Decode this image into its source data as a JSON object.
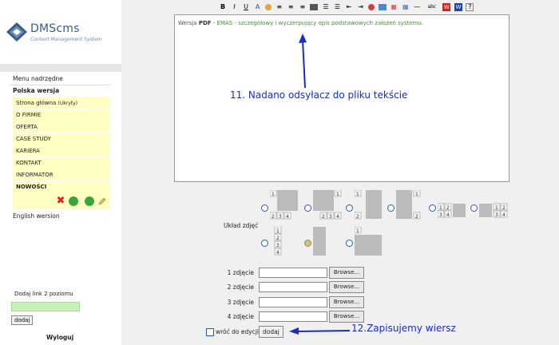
{
  "logo": {
    "title": "DMScms",
    "subtitle": "Content Management System"
  },
  "menu": {
    "parent": "Menu nadrzędne",
    "section": "Polska wersja",
    "items": [
      {
        "label": "Strona główna",
        "badge": "(Ukryty)"
      },
      {
        "label": "O FIRMIE"
      },
      {
        "label": "OFERTA"
      },
      {
        "label": "CASE STUDY"
      },
      {
        "label": "KARIERA"
      },
      {
        "label": "KONTAKT"
      },
      {
        "label": "INFORMATOR"
      },
      {
        "label": "NOWOŚCI"
      }
    ],
    "english": "English wersion"
  },
  "sidebar_bottom": {
    "add_label": "Dodaj link 2 poziomu",
    "add_button": "dodaj",
    "logout": "Wyloguj"
  },
  "toolbar": [
    "B",
    "I",
    "U",
    "A"
  ],
  "editor": {
    "prefix": "Wersja",
    "pdf": "PDF",
    "dash": " - ",
    "link_text": "EMAS - szczegółowy i wyczerpujący opis podstawowych założeń systemu."
  },
  "annotations": {
    "a1": "11. Nadano odsyłacz do pliku tekście",
    "a2": "12.Zapisujemy wiersz"
  },
  "layout": {
    "label": "Układ zdjęć",
    "selected_index": 6
  },
  "photos": {
    "rows": [
      {
        "label": "1 zdjęcie",
        "browse": "Browse..."
      },
      {
        "label": "2 zdjęcie",
        "browse": "Browse..."
      },
      {
        "label": "3 zdjęcie",
        "browse": "Browse..."
      },
      {
        "label": "4 zdjęcie",
        "browse": "Browse..."
      }
    ]
  },
  "footer": {
    "return_label": "wróć do edycji",
    "save_button": "dodaj"
  },
  "colors": {
    "menu_bg": "#ffffc4",
    "annotation": "#1a2ec0",
    "input_green": "#c6f0b8"
  }
}
